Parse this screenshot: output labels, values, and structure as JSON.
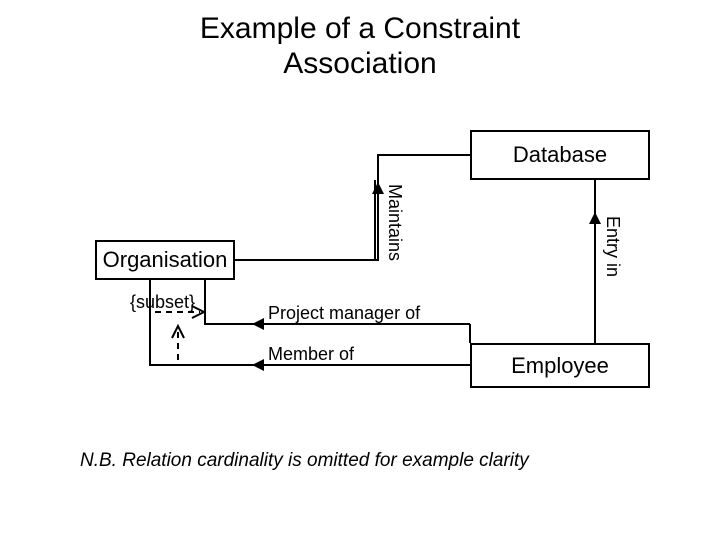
{
  "title_line1": "Example of a Constraint",
  "title_line2": "Association",
  "boxes": {
    "database": "Database",
    "organisation": "Organisation",
    "employee": "Employee"
  },
  "labels": {
    "maintains": "Maintains",
    "entry_in": "Entry in",
    "project_manager_of": "Project manager of",
    "member_of": "Member of"
  },
  "constraint": "{subset}",
  "footnote": "N.B. Relation cardinality is omitted for example clarity"
}
